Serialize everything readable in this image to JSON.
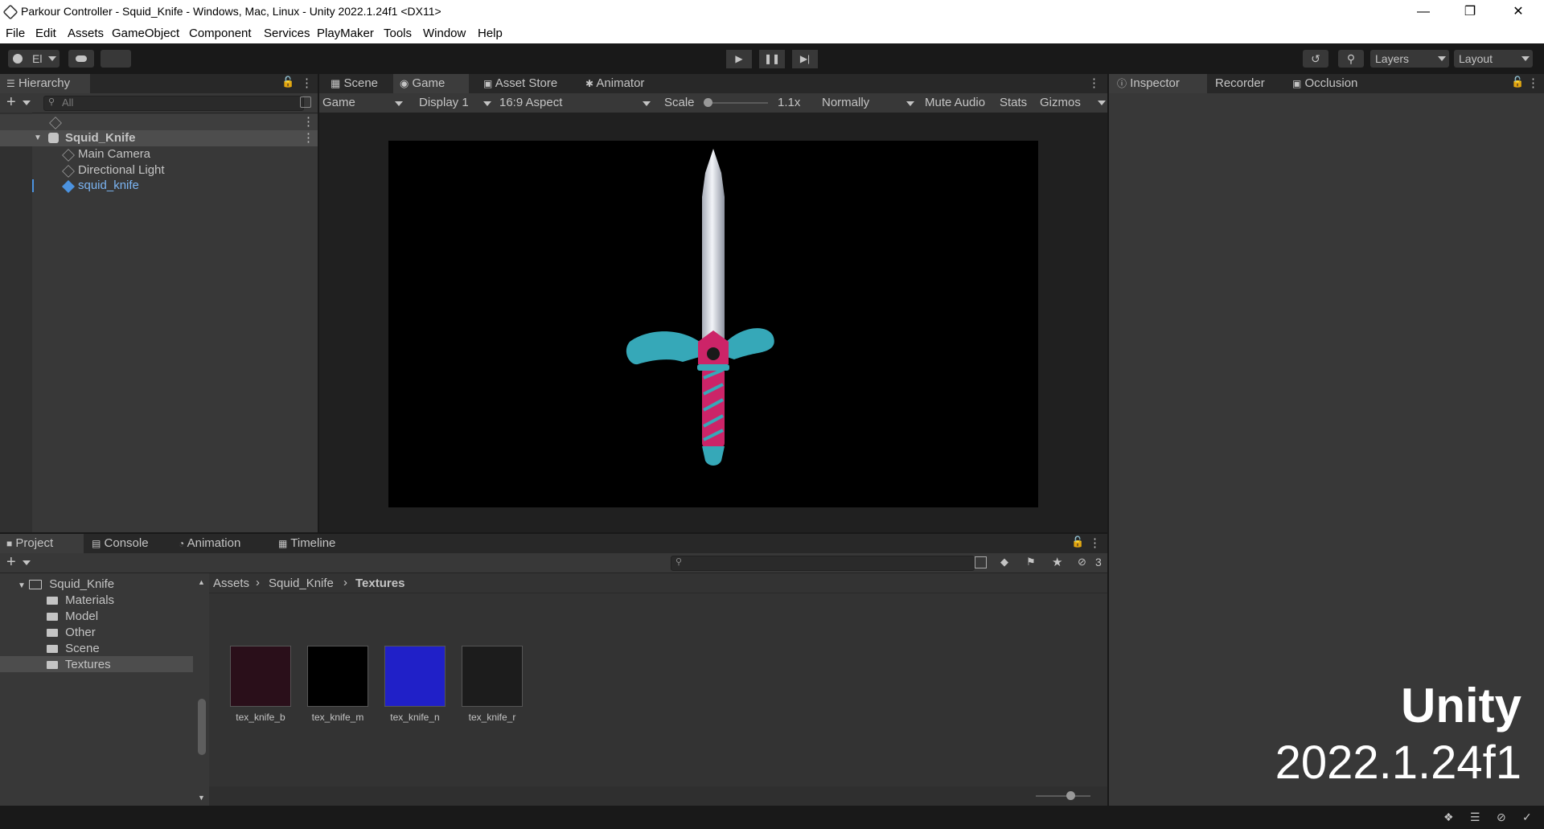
{
  "window": {
    "title": "Parkour Controller - Squid_Knife - Windows, Mac, Linux - Unity 2022.1.24f1 <DX11>",
    "controls": [
      "minimize",
      "restore",
      "close"
    ]
  },
  "menu": [
    "File",
    "Edit",
    "Assets",
    "GameObject",
    "Component",
    "Services",
    "PlayMaker",
    "Tools",
    "Window",
    "Help"
  ],
  "toolbar": {
    "account_label": "El",
    "layers_label": "Layers",
    "layout_label": "Layout"
  },
  "hierarchy": {
    "tab_label": "Hierarchy",
    "search_placeholder": "All",
    "scene_name": "Squid_Knife",
    "items": [
      "Main Camera",
      "Directional Light",
      "squid_knife"
    ]
  },
  "center_tabs": [
    "Scene",
    "Game",
    "Asset Store",
    "Animator"
  ],
  "game_toolbar": {
    "mode": "Game",
    "display": "Display 1",
    "aspect": "16:9 Aspect",
    "scale_label": "Scale",
    "scale_value": "1.1x",
    "play_mode": "Normally",
    "mute_audio": "Mute Audio",
    "stats": "Stats",
    "gizmos": "Gizmos"
  },
  "inspector_tabs": [
    "Inspector",
    "Recorder",
    "Occlusion"
  ],
  "bottom_tabs": [
    "Project",
    "Console",
    "Animation",
    "Timeline"
  ],
  "project": {
    "hidden_count": "3",
    "tree": {
      "root": "Squid_Knife",
      "children": [
        "Materials",
        "Model",
        "Other",
        "Scene",
        "Textures"
      ],
      "selected": "Textures"
    },
    "breadcrumb": [
      "Assets",
      "Squid_Knife",
      "Textures"
    ],
    "assets": [
      {
        "name": "tex_knife_b",
        "color": "#2a0f1a"
      },
      {
        "name": "tex_knife_m",
        "color": "#000000"
      },
      {
        "name": "tex_knife_n",
        "color": "#2020c8"
      },
      {
        "name": "tex_knife_r",
        "color": "#1c1c1c"
      }
    ]
  },
  "watermark": {
    "line1": "Unity",
    "line2": "2022.1.24f1"
  },
  "colors": {
    "panel": "#383838",
    "selection_blue": "#4c93e0",
    "knife_teal": "#38a8b8",
    "knife_pink": "#d8206a"
  }
}
